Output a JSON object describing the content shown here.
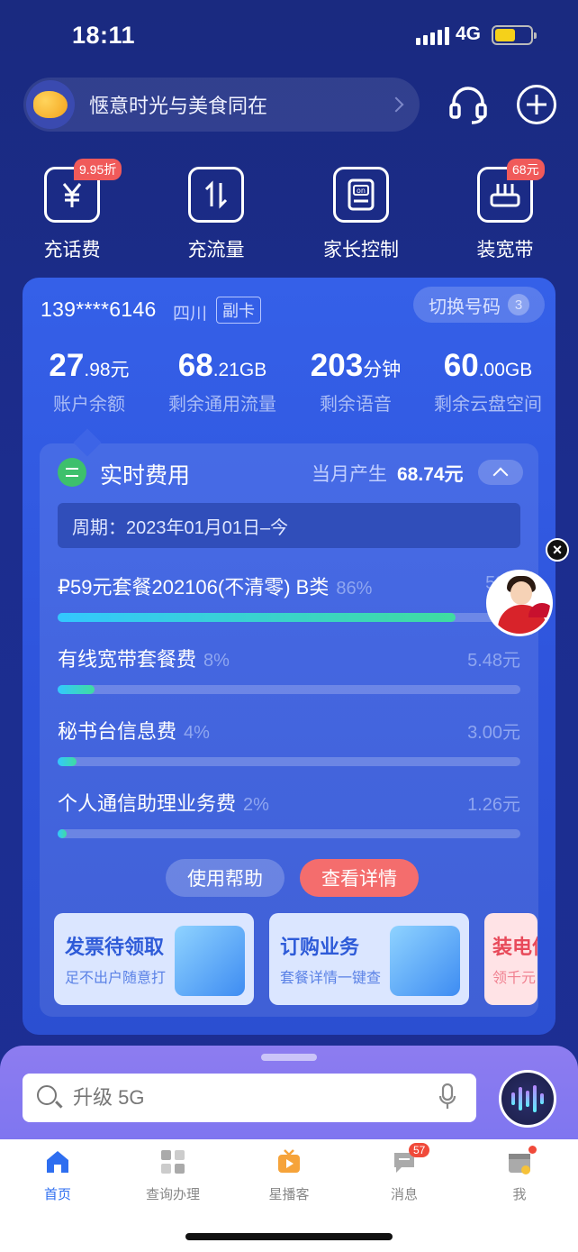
{
  "status_bar": {
    "time": "18:11",
    "network": "4G"
  },
  "top_bar": {
    "title": "惬意时光与美食同在"
  },
  "quick_actions": [
    {
      "label": "充话费",
      "icon": "yuan-icon",
      "badge": "9.95折"
    },
    {
      "label": "充流量",
      "icon": "data-transfer-icon",
      "badge": ""
    },
    {
      "label": "家长控制",
      "icon": "parental-control-icon",
      "badge": ""
    },
    {
      "label": "装宽带",
      "icon": "router-icon",
      "badge": "68元"
    }
  ],
  "account": {
    "phone": "139****6146",
    "region": "四川",
    "card_type": "副卡",
    "switch_label": "切换号码",
    "switch_count": "3"
  },
  "stats": [
    {
      "num": "27",
      "unit": ".98元",
      "label": "账户余额"
    },
    {
      "num": "68",
      "unit": ".21GB",
      "label": "剩余通用流量"
    },
    {
      "num": "203",
      "unit": "分钟",
      "label": "剩余语音"
    },
    {
      "num": "60",
      "unit": ".00GB",
      "label": "剩余云盘空间"
    }
  ],
  "realtime": {
    "title": "实时费用",
    "month_label": "当月产生",
    "month_amount": "68.74元",
    "period": "周期：2023年01月01日–今",
    "items": [
      {
        "name": "₽59元套餐202106(不清零) B类",
        "percent": "86%",
        "amount": "59.0",
        "fill": 0.86
      },
      {
        "name": "有线宽带套餐费",
        "percent": "8%",
        "amount": "5.48元",
        "fill": 0.08
      },
      {
        "name": "秘书台信息费",
        "percent": "4%",
        "amount": "3.00元",
        "fill": 0.04
      },
      {
        "name": "个人通信助理业务费",
        "percent": "2%",
        "amount": "1.26元",
        "fill": 0.02
      }
    ],
    "help_label": "使用帮助",
    "detail_label": "查看详情"
  },
  "promos": [
    {
      "title": "发票待领取",
      "subtitle": "足不出户随意打"
    },
    {
      "title": "订购业务",
      "subtitle": "套餐详情一键查"
    },
    {
      "title": "装电信",
      "subtitle": "领千元"
    }
  ],
  "search": {
    "placeholder": "升级 5G"
  },
  "tabs": [
    {
      "label": "首页",
      "icon": "home-icon",
      "active": true
    },
    {
      "label": "查询办理",
      "icon": "grid-icon",
      "active": false
    },
    {
      "label": "星播客",
      "icon": "tv-icon",
      "active": false
    },
    {
      "label": "消息",
      "icon": "message-icon",
      "active": false,
      "badge": "57"
    },
    {
      "label": "我",
      "icon": "calendar-profile-icon",
      "active": false
    }
  ],
  "colors": {
    "accent": "#2e6ef0",
    "card": "#3560e8",
    "danger": "#f05a5a",
    "progress": "#33c8ff"
  }
}
